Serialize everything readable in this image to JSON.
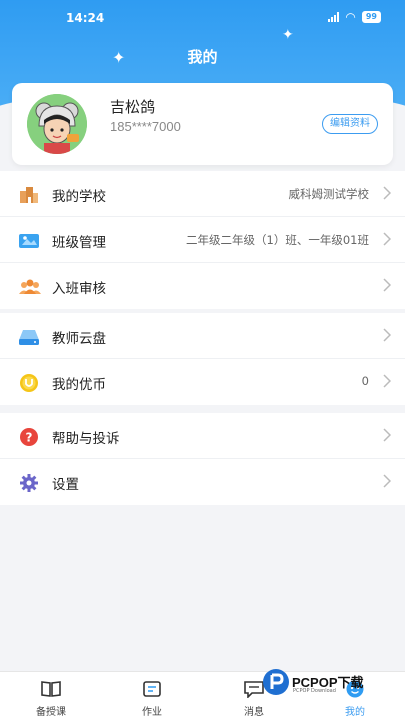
{
  "status_bar": {
    "time": "14:24",
    "battery": "99"
  },
  "page": {
    "title": "我的"
  },
  "profile": {
    "name": "吉松鸽",
    "phone": "185****7000",
    "edit_label": "编辑资料"
  },
  "menu_group_1": [
    {
      "label": "我的学校",
      "value": "威科姆测试学校",
      "icon": "school-icon"
    },
    {
      "label": "班级管理",
      "value": "二年级二年级（1）班、一年级01班",
      "icon": "class-icon"
    },
    {
      "label": "入班审核",
      "value": "",
      "icon": "people-icon"
    }
  ],
  "menu_group_2": [
    {
      "label": "教师云盘",
      "value": "",
      "icon": "cloud-drive-icon"
    },
    {
      "label": "我的优币",
      "value": "0",
      "icon": "coin-icon"
    }
  ],
  "menu_group_3": [
    {
      "label": "帮助与投诉",
      "value": "",
      "icon": "help-icon"
    },
    {
      "label": "设置",
      "value": "",
      "icon": "gear-icon"
    }
  ],
  "tabs": [
    {
      "label": "备授课",
      "icon": "book-icon",
      "active": false
    },
    {
      "label": "作业",
      "icon": "homework-icon",
      "active": false
    },
    {
      "label": "消息",
      "icon": "message-icon",
      "active": false
    },
    {
      "label": "我的",
      "icon": "profile-face-icon",
      "active": true
    }
  ],
  "watermark": {
    "brand": "PCPOP下载",
    "sub": "PCPOP Download"
  },
  "colors": {
    "primary": "#2f9cf2",
    "background": "#f3f4f7",
    "coin": "#f5c518",
    "help": "#e8453c",
    "gear": "#6b66c9"
  }
}
